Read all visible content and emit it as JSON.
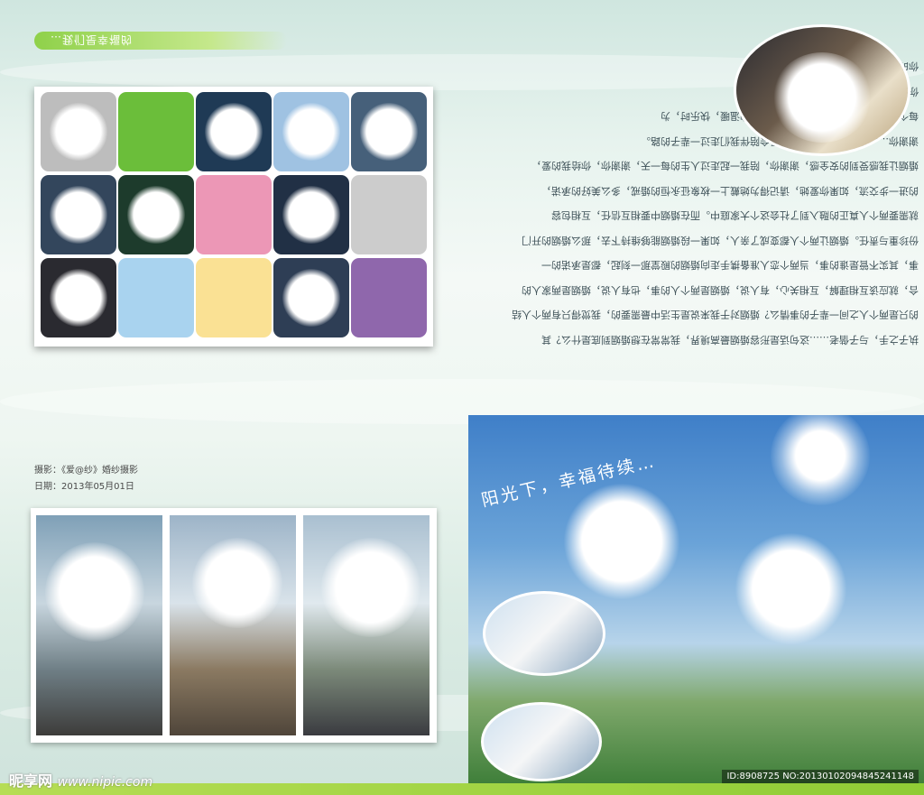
{
  "header": {
    "title_mirrored": "…我们是幸福的"
  },
  "grid": {
    "tiles": [
      {
        "kind": "photo",
        "bg": "#bdbdbd"
      },
      {
        "kind": "color",
        "bg": "#6bbe3a"
      },
      {
        "kind": "photo",
        "bg": "#1f3a55"
      },
      {
        "kind": "photo",
        "bg": "#9fc2e2"
      },
      {
        "kind": "photo",
        "bg": "#46607a"
      },
      {
        "kind": "photo",
        "bg": "#33465c"
      },
      {
        "kind": "photo",
        "bg": "#1d3b2c"
      },
      {
        "kind": "color",
        "bg": "#ec97b6"
      },
      {
        "kind": "photo",
        "bg": "#213045"
      },
      {
        "kind": "color",
        "bg": "#cccccc"
      },
      {
        "kind": "photo",
        "bg": "#2a2a30"
      },
      {
        "kind": "color",
        "bg": "#a9d3ef"
      },
      {
        "kind": "color",
        "bg": "#fae194"
      },
      {
        "kind": "photo",
        "bg": "#2e3e55"
      },
      {
        "kind": "color",
        "bg": "#8f67ac"
      }
    ]
  },
  "text_block": {
    "lines": [
      "执子之手，与子偕老……这句话是形容婚姻最高境界，我常常在想婚姻到底是什么？其",
      "的只是两个人之间一辈子的事情么？婚姻对于我来说是生活中最需要的，我觉得只有两个人结",
      "合，就应该互相理解，互相关心，有人说，婚姻是两个人的事，也有人说，婚姻是两家人的",
      "事，其实不管是谁的事，当两个恋人准备携手走向婚姻的殿堂那一刻起，都是承诺的一",
      "份珍重与责任。婚姻让两个人都变成了亲人，如果一段婚姻能够维持下去，那么婚姻的开门",
      "就需要两个人真正的融入到了社会这个大家庭中。而在婚姻中要相互信任，互相包容",
      "的进一步交流，如果你爱她，请记得为她戴上一枚象征永恒的婚戒，多么美好的承诺，",
      "婚姻让我感受到的安全感，谢谢你，陪我一起走过人生的每一天，谢谢你，你给我的爱，",
      "谢谢你……我会一直爱你，这份爱会陪伴我们走过一辈子的路。",
      "每个人都有自己的幸福，伤心时，有家的温暖，快乐时，为",
      "你送上祝福，我们一起，执手走过每一天，",
      "你的笑容与幸福。"
    ]
  },
  "credits": {
    "photographer": "摄影：《爱@纱》婚纱摄影",
    "date": "日期：2013年05月01日"
  },
  "big_photo": {
    "caption": "阳光下，幸福待续…"
  },
  "footer": {
    "watermark_brand": "昵享网",
    "watermark_url": "www.nipic.com",
    "id_text": "ID:8908725 NO:20130102094845241148"
  }
}
